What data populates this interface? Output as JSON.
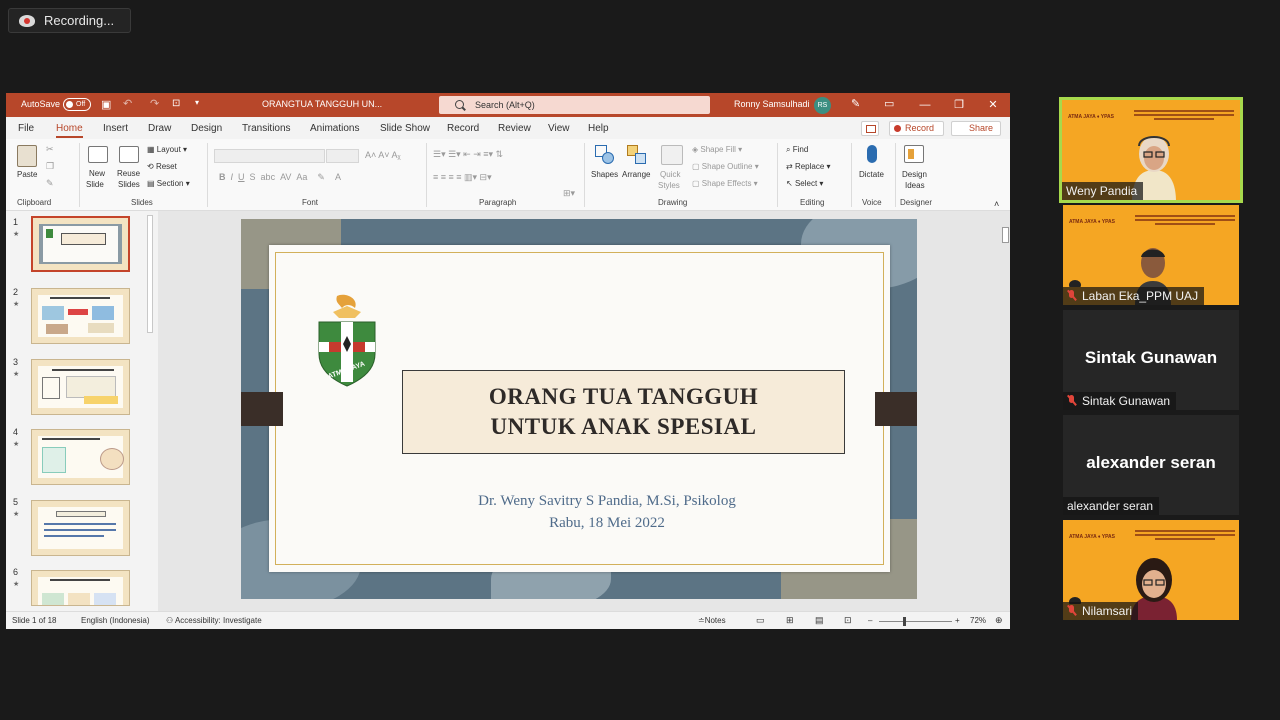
{
  "recording": {
    "label": "Recording..."
  },
  "ppt": {
    "titlebar": {
      "autosave": "AutoSave",
      "autosave_state": "Off",
      "filename": "ORANGTUA TANGGUH UN...",
      "search_placeholder": "Search (Alt+Q)",
      "user": "Ronny Samsulhadi",
      "user_initials": "RS"
    },
    "menu": [
      "File",
      "Home",
      "Insert",
      "Draw",
      "Design",
      "Transitions",
      "Animations",
      "Slide Show",
      "Record",
      "Review",
      "View",
      "Help"
    ],
    "menu_active": "Home",
    "record_button": "Record",
    "share_button": "Share",
    "ribbon": {
      "clipboard": {
        "paste": "Paste",
        "group": "Clipboard"
      },
      "slides": {
        "new_slide": "New",
        "new_slide2": "Slide",
        "reuse": "Reuse",
        "reuse2": "Slides",
        "layout": "Layout",
        "reset": "Reset",
        "section": "Section",
        "group": "Slides"
      },
      "font": {
        "group": "Font"
      },
      "paragraph": {
        "group": "Paragraph"
      },
      "drawing": {
        "shapes": "Shapes",
        "arrange": "Arrange",
        "quick": "Quick",
        "styles": "Styles",
        "shape_fill": "Shape Fill",
        "shape_outline": "Shape Outline",
        "shape_effects": "Shape Effects",
        "group": "Drawing"
      },
      "editing": {
        "find": "Find",
        "replace": "Replace",
        "select": "Select",
        "group": "Editing"
      },
      "voice": {
        "dictate": "Dictate",
        "group": "Voice"
      },
      "designer": {
        "design": "Design",
        "ideas": "Ideas",
        "group": "Designer"
      }
    },
    "thumbnails": [
      {
        "num": "1",
        "title": "ORANG TUA TANGGUH UNTUK ANAK SPESIAL"
      },
      {
        "num": "2",
        "title": "HAL YANG AKAN DIBAHAS"
      },
      {
        "num": "3",
        "title": "ORANGTUA DENGAN ANAK SPESIAL"
      },
      {
        "num": "4",
        "title": ""
      },
      {
        "num": "5",
        "title": ""
      },
      {
        "num": "6",
        "title": "SUMBER KETANGGUHAN DIRI"
      }
    ],
    "slide": {
      "title_line1": "ORANG TUA TANGGUH",
      "title_line2": "UNTUK ANAK SPESIAL",
      "presenter": "Dr. Weny Savitry S Pandia, M.Si, Psikolog",
      "date": "Rabu, 18 Mei 2022",
      "logo_text": "ATMA JAYA"
    },
    "status": {
      "slide_of": "Slide 1 of 18",
      "language": "English (Indonesia)",
      "accessibility": "Accessibility: Investigate",
      "notes": "Notes",
      "zoom": "72%"
    }
  },
  "participants": [
    {
      "name": "Weny Pandia",
      "video": true,
      "active": true,
      "muted": false
    },
    {
      "name": "Laban Eka_PPM UAJ",
      "video": true,
      "muted": true
    },
    {
      "name": "Sintak Gunawan",
      "video": false,
      "muted": true
    },
    {
      "name": "alexander seran",
      "video": false,
      "muted": false
    },
    {
      "name": "Nilamsari",
      "video": true,
      "muted": true
    }
  ],
  "colors": {
    "ppt_accent": "#b7472a",
    "tile_bg": "#f5a623",
    "active_border": "#a7d94c"
  }
}
